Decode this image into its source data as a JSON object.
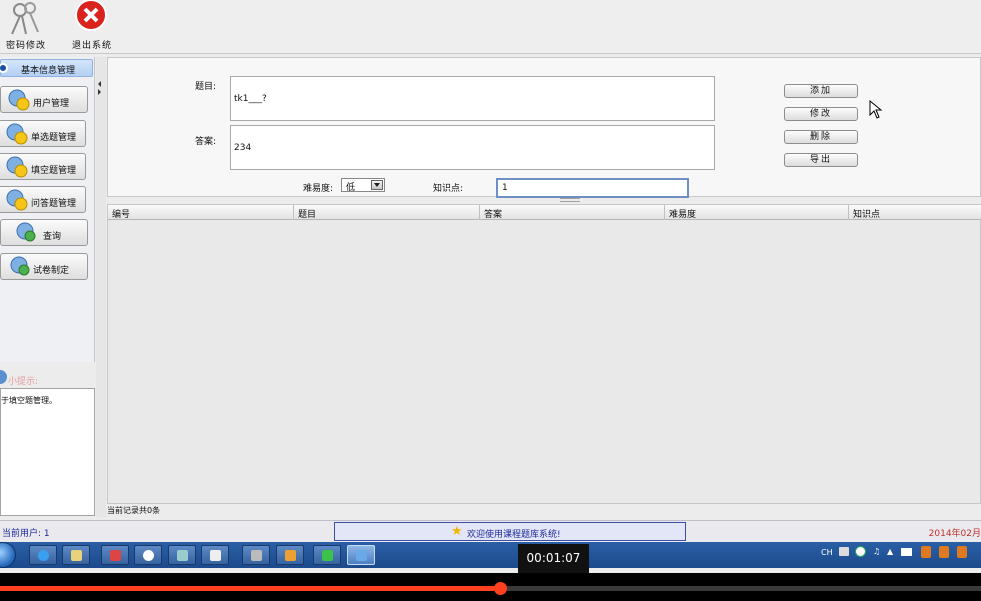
{
  "toolbar": {
    "change_password_label": "密码修改",
    "exit_label": "退出系统"
  },
  "sidebar": {
    "header": "基本信息管理",
    "items": [
      {
        "label": "用户管理",
        "icon": "user-smiley-icon"
      },
      {
        "label": "单选题管理",
        "icon": "user-smiley-icon"
      },
      {
        "label": "填空题管理",
        "icon": "user-smiley-icon"
      },
      {
        "label": "问答题管理",
        "icon": "user-smiley-icon"
      },
      {
        "label": "查询",
        "icon": "user-green-icon"
      },
      {
        "label": "试卷制定",
        "icon": "user-green-icon"
      }
    ],
    "tip_title": "小提示:",
    "tip_text": "于填空题管理。"
  },
  "form": {
    "question_label": "题目:",
    "question_value": "tk1___?",
    "answer_label": "答案:",
    "answer_value": "234",
    "difficulty_label": "难易度:",
    "difficulty_value": "低",
    "knowledge_label": "知识点:",
    "knowledge_value": "1"
  },
  "actions": {
    "add": "添加",
    "edit": "修改",
    "delete": "删除",
    "export": "导出"
  },
  "table": {
    "columns": [
      "编号",
      "题目",
      "答案",
      "难易度",
      "知识点"
    ],
    "rows": [],
    "record_count": "当前记录共0条"
  },
  "status": {
    "current_user": "当前用户: 1",
    "welcome": "欢迎使用课程题库系统!",
    "date": "2014年02月"
  },
  "taskbar": {
    "tray_lang": "CH"
  },
  "video": {
    "timecode": "00:01:07",
    "progress": 0.51
  },
  "colors": {
    "accent": "#1e2a9a",
    "date": "#c0332a",
    "progress": "#ff3f1e"
  }
}
